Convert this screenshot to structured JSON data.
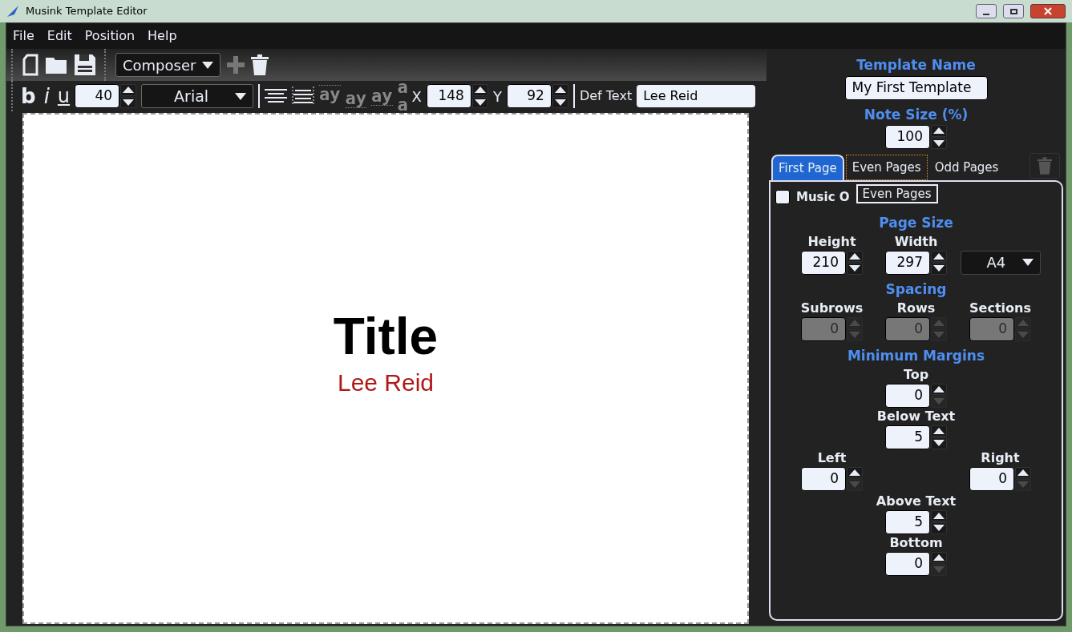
{
  "window": {
    "title": "Musink Template Editor"
  },
  "menu": [
    "File",
    "Edit",
    "Position",
    "Help"
  ],
  "toolbar": {
    "template_type": "Composer",
    "add_enabled": false,
    "delete_enabled": true
  },
  "format_bar": {
    "bold": "b",
    "italic": "i",
    "underline": "u",
    "font_size": {
      "value": "40",
      "disabled": false
    },
    "font": "Arial",
    "text_styles": [
      {
        "label": "ay",
        "kind": "top"
      },
      {
        "label": "ay",
        "kind": "bottom"
      },
      {
        "label": "ay",
        "kind": "middle"
      },
      {
        "label": "a a",
        "kind": "stacked"
      }
    ],
    "x_label": "X",
    "x": {
      "value": "148",
      "disabled": false
    },
    "y_label": "Y",
    "y": {
      "value": "92",
      "disabled": false
    },
    "def_text_label": "Def Text",
    "def_text": "Lee Reid"
  },
  "canvas": {
    "items": [
      {
        "text": "Title",
        "kind": "title"
      },
      {
        "text": "Lee Reid",
        "kind": "subtitle"
      }
    ]
  },
  "panel": {
    "template_name_label": "Template Name",
    "template_name": "My First Template",
    "note_size_label": "Note Size (%)",
    "note_size": {
      "value": "100",
      "disabled": false
    },
    "tabs": [
      {
        "label": "First Page",
        "selected": true,
        "focused": false
      },
      {
        "label": "Even Pages",
        "selected": false,
        "focused": true
      },
      {
        "label": "Odd Pages",
        "selected": false,
        "focused": false
      }
    ],
    "delete_tab_enabled": false,
    "music_checkbox": {
      "label": "Music O",
      "checked": false
    },
    "tooltip": "Even Pages",
    "page_size": {
      "title": "Page Size",
      "fields": [
        {
          "label": "Height",
          "value": "210",
          "disabled": false
        },
        {
          "label": "Width",
          "value": "297",
          "disabled": false
        }
      ],
      "paper": "A4"
    },
    "spacing": {
      "title": "Spacing",
      "fields": [
        {
          "label": "Subrows",
          "value": "0",
          "disabled": true
        },
        {
          "label": "Rows",
          "value": "0",
          "disabled": true
        },
        {
          "label": "Sections",
          "value": "0",
          "disabled": true
        }
      ]
    },
    "margins": {
      "title": "Minimum Margins",
      "top": {
        "label": "Top",
        "value": "0",
        "disabled": false,
        "at_minimum": true
      },
      "below_text": {
        "label": "Below Text",
        "value": "5",
        "disabled": false
      },
      "left": {
        "label": "Left",
        "value": "0",
        "disabled": false,
        "at_minimum": true
      },
      "right": {
        "label": "Right",
        "value": "0",
        "disabled": false,
        "at_minimum": true
      },
      "above_text": {
        "label": "Above Text",
        "value": "5",
        "disabled": false
      },
      "bottom": {
        "label": "Bottom",
        "value": "0",
        "disabled": false,
        "at_minimum": true
      }
    }
  }
}
